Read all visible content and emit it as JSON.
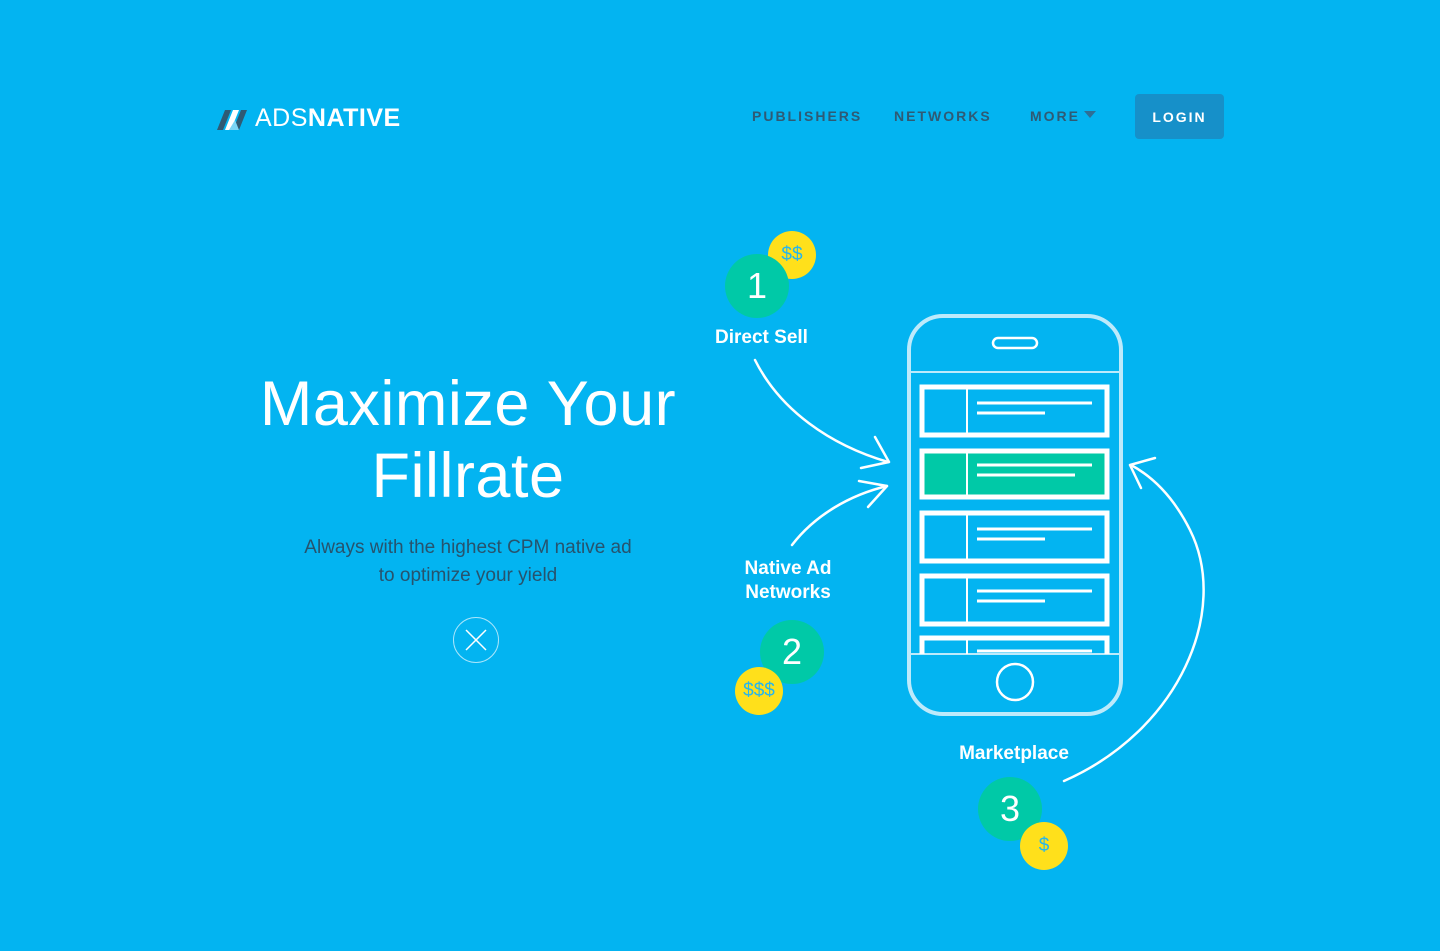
{
  "header": {
    "logo_light": "ADS",
    "logo_bold": "NATIVE",
    "logo_icon": "adsnative-logo-icon",
    "nav": {
      "publishers": "PUBLISHERS",
      "networks": "NETWORKS",
      "more": "MORE"
    },
    "login": "LOGIN"
  },
  "hero": {
    "title_line1": "Maximize Your",
    "title_line2": "Fillrate",
    "subtitle_line1": "Always with the highest CPM native ad",
    "subtitle_line2": "to optimize your yield",
    "close_icon": "close-icon"
  },
  "illustration": {
    "steps": [
      {
        "number": "1",
        "label": "Direct Sell",
        "coin": "$$"
      },
      {
        "number": "2",
        "label_line1": "Native Ad",
        "label_line2": "Networks",
        "coin": "$$$"
      },
      {
        "number": "3",
        "label": "Marketplace",
        "coin": "$"
      }
    ],
    "phone_icon": "phone-icon",
    "arrow_icon": "arrow-icon"
  },
  "colors": {
    "background": "#03b4f1",
    "nav_text": "#2f5a74",
    "login_bg": "#1690c9",
    "teal": "#00c9a7",
    "coin": "#ffe01b",
    "subtitle": "#27536d"
  }
}
